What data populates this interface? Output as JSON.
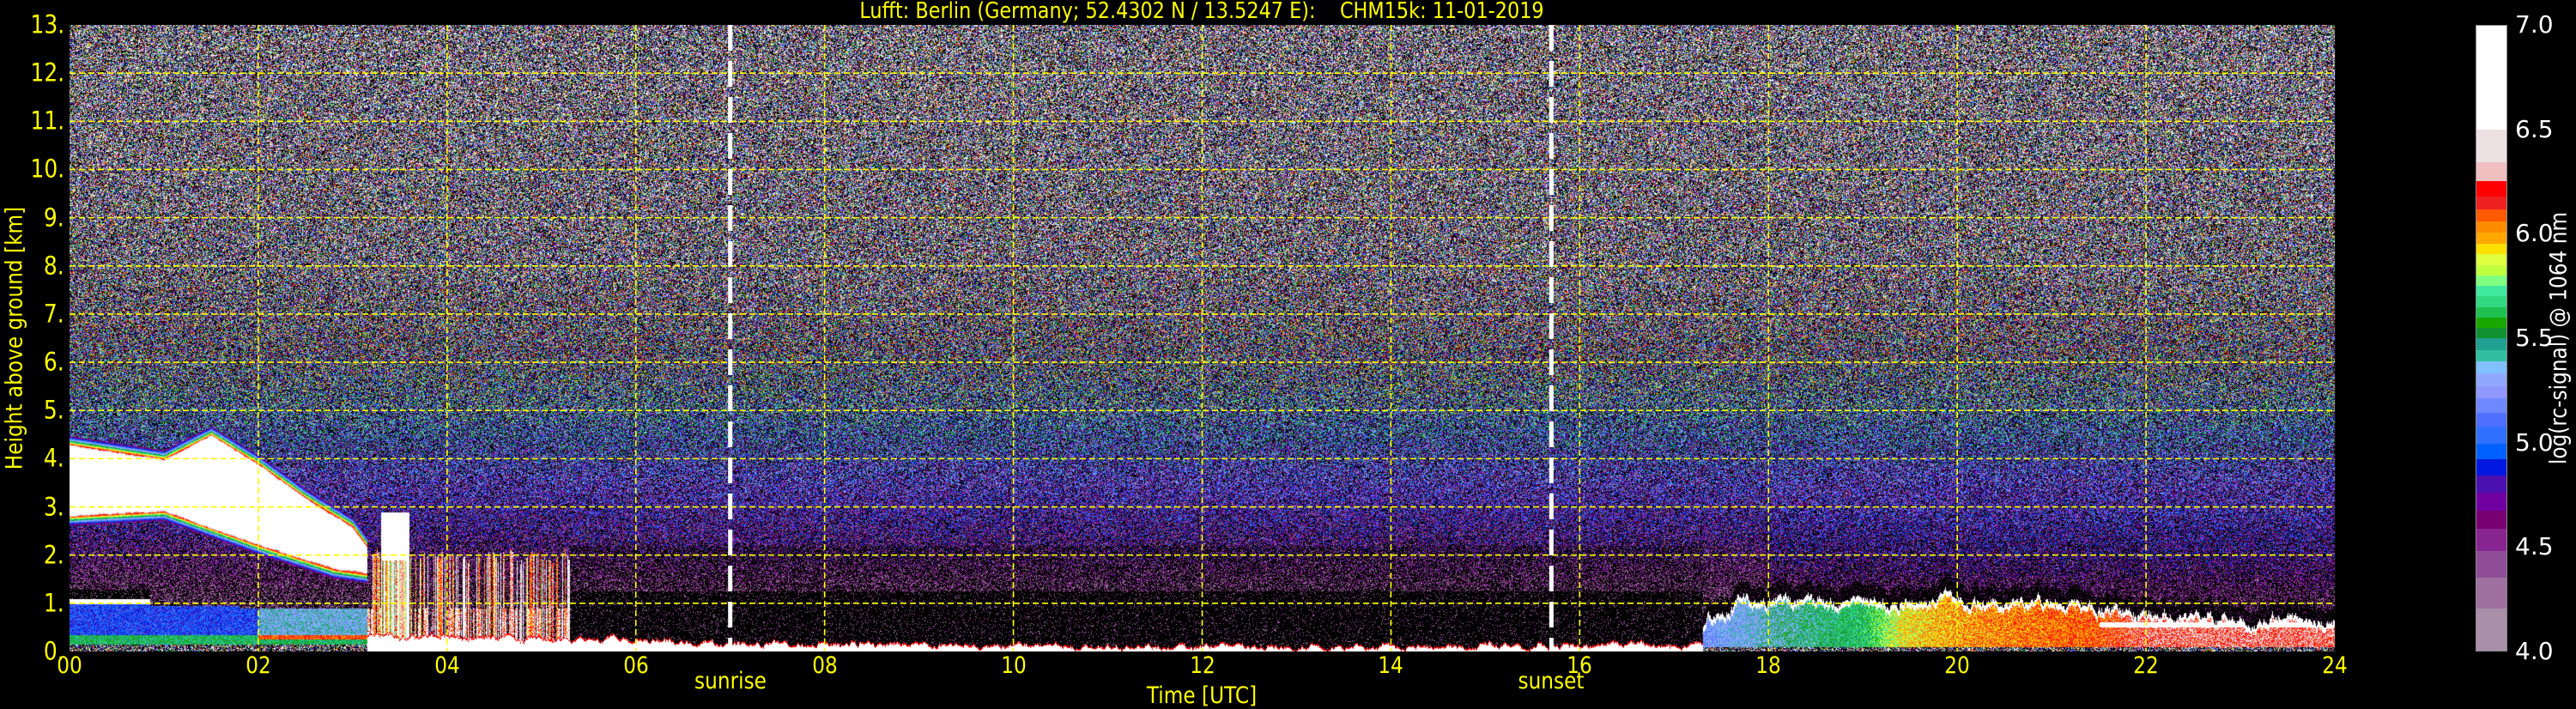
{
  "chart_data": {
    "type": "heatmap",
    "title": "Lufft: Berlin (Germany; 52.4302 N / 13.5247 E):    CHM15k: 11-01-2019",
    "xlabel": "Time [UTC]",
    "ylabel": "Height above ground [km]",
    "xlim": [
      0,
      24
    ],
    "ylim": [
      0,
      13
    ],
    "grid": true,
    "x_ticks": [
      0,
      2,
      4,
      6,
      8,
      10,
      12,
      14,
      16,
      18,
      20,
      22,
      24
    ],
    "x_tick_labels": [
      "00",
      "02",
      "04",
      "06",
      "08",
      "10",
      "12",
      "14",
      "16",
      "18",
      "20",
      "22",
      "24"
    ],
    "y_ticks": [
      0,
      1,
      2,
      3,
      4,
      5,
      6,
      7,
      8,
      9,
      10,
      11,
      12,
      13
    ],
    "y_tick_labels": [
      "0.",
      "1.",
      "2.",
      "3.",
      "4.",
      "5.",
      "6.",
      "7.",
      "8.",
      "9.",
      "10.",
      "11.",
      "12.",
      "13."
    ],
    "annotations": [
      {
        "label": "sunrise",
        "x": 7.0
      },
      {
        "label": "sunset",
        "x": 15.7
      }
    ],
    "colorbar": {
      "label": "log(rc-signal) @ 1064 nm",
      "range": [
        4.0,
        7.0
      ],
      "ticks": [
        4.0,
        4.5,
        5.0,
        5.5,
        6.0,
        6.5,
        7.0
      ],
      "tick_labels": [
        "4.0",
        "4.5",
        "5.0",
        "5.5",
        "6.0",
        "6.5",
        "7.0"
      ],
      "bounds": [
        7.0,
        6.503,
        6.345,
        6.254,
        6.179,
        6.12,
        6.06,
        6.006,
        5.952,
        5.902,
        5.85,
        5.8,
        5.751,
        5.701,
        5.649,
        5.599,
        5.548,
        5.498,
        5.444,
        5.39,
        5.331,
        5.271,
        5.21,
        5.141,
        5.076,
        4.994,
        4.921,
        4.839,
        4.757,
        4.67,
        4.584,
        4.476,
        4.352,
        4.201,
        4.0
      ],
      "colors": [
        "#ffffff",
        "#ece0e2",
        "#f0c0c0",
        "#ff0000",
        "#ee2020",
        "#ff5a00",
        "#ff8c00",
        "#ffa800",
        "#ffe000",
        "#e0ff40",
        "#c0ff40",
        "#80ff80",
        "#40e8a0",
        "#30d880",
        "#20c050",
        "#18a800",
        "#109030",
        "#20a090",
        "#30c0a0",
        "#80c0ff",
        "#90a8ff",
        "#9098ff",
        "#7088ff",
        "#5070ff",
        "#3070ff",
        "#0060ff",
        "#0018e0",
        "#4a10b0",
        "#7000a0",
        "#780070",
        "#882490",
        "#904e98",
        "#a070a0",
        "#a890a8"
      ]
    },
    "colors": {
      "text": "#ffff00",
      "grid": "#ffff00",
      "sun_lines": "#ffffff",
      "background": "#000000"
    }
  }
}
